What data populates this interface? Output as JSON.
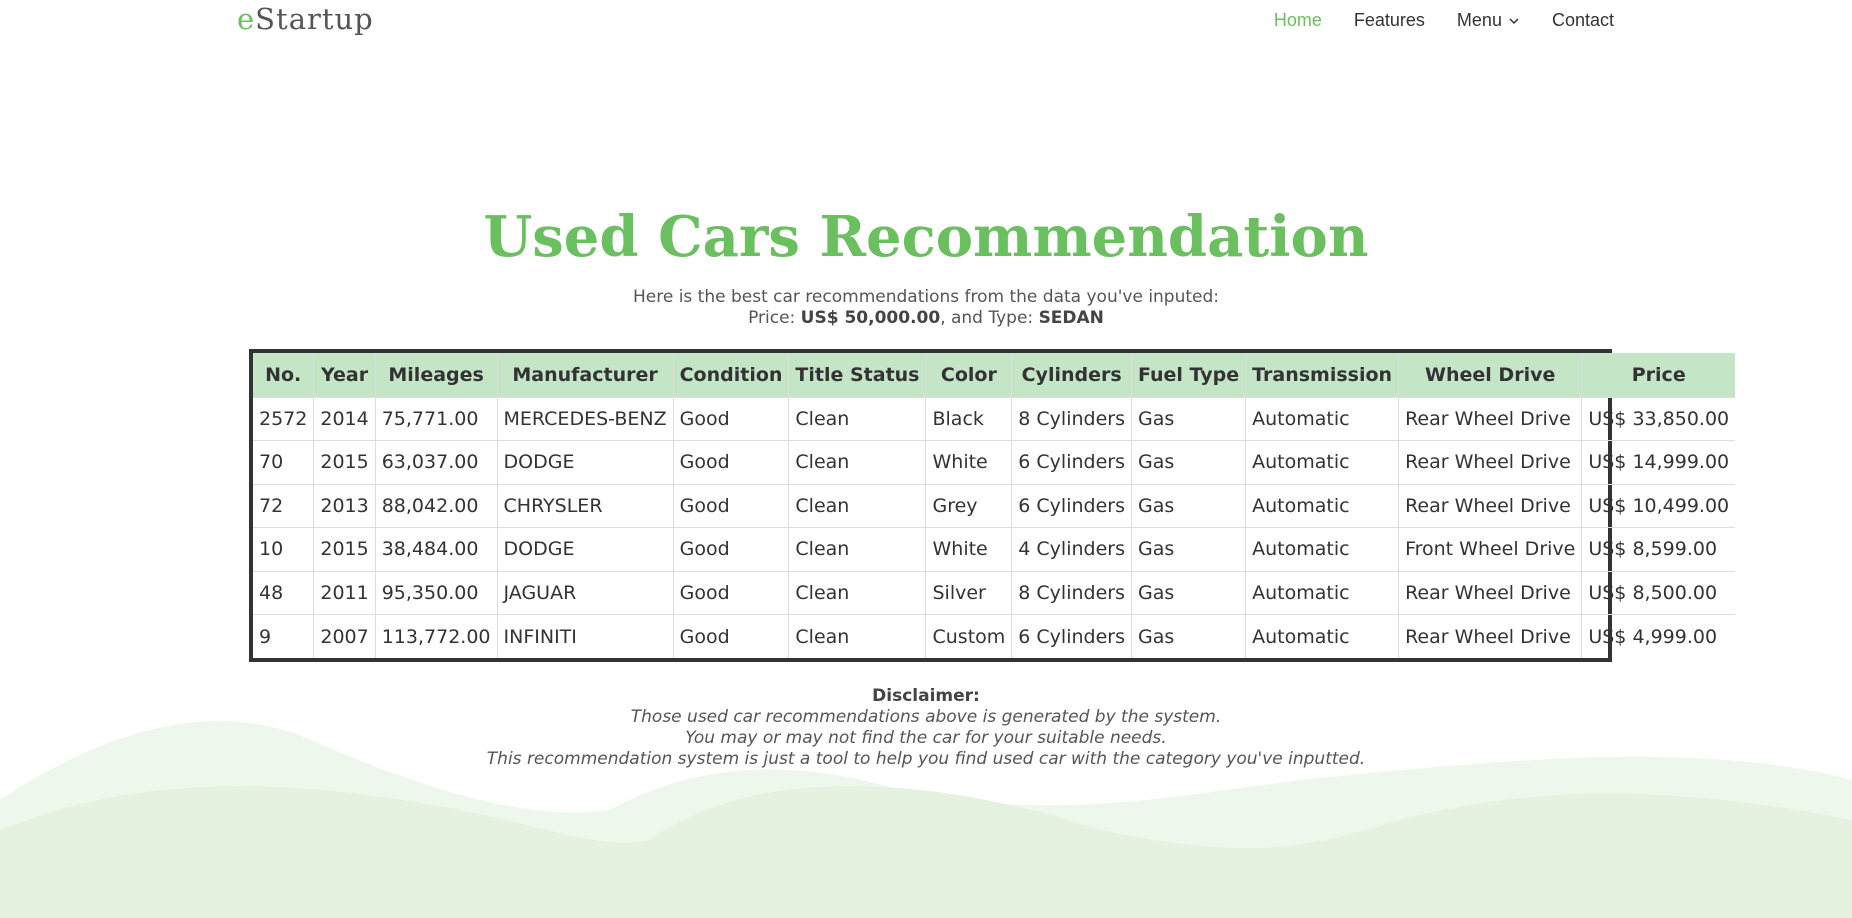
{
  "brand": {
    "prefix": "e",
    "name": "Startup"
  },
  "nav": {
    "home": "Home",
    "features": "Features",
    "menu": "Menu",
    "contact": "Contact"
  },
  "colors": {
    "accent": "#6abf5e",
    "header_bg": "#c4e6c6",
    "wave": "#e6f3e2"
  },
  "page_title": "Used Cars Recommendation",
  "intro": {
    "line1": "Here is the best car recommendations from the data you've inputed:",
    "price_label": "Price:",
    "price_value": "US$ 50,000.00",
    "type_label": ", and Type:",
    "type_value": "SEDAN"
  },
  "table": {
    "headers": [
      "No.",
      "Year",
      "Mileages",
      "Manufacturer",
      "Condition",
      "Title Status",
      "Color",
      "Cylinders",
      "Fuel Type",
      "Transmission",
      "Wheel Drive",
      "Price"
    ],
    "rows": [
      [
        "2572",
        "2014",
        "75,771.00",
        "MERCEDES-BENZ",
        "Good",
        "Clean",
        "Black",
        "8 Cylinders",
        "Gas",
        "Automatic",
        "Rear Wheel Drive",
        "US$ 33,850.00"
      ],
      [
        "70",
        "2015",
        "63,037.00",
        "DODGE",
        "Good",
        "Clean",
        "White",
        "6 Cylinders",
        "Gas",
        "Automatic",
        "Rear Wheel Drive",
        "US$ 14,999.00"
      ],
      [
        "72",
        "2013",
        "88,042.00",
        "CHRYSLER",
        "Good",
        "Clean",
        "Grey",
        "6 Cylinders",
        "Gas",
        "Automatic",
        "Rear Wheel Drive",
        "US$ 10,499.00"
      ],
      [
        "10",
        "2015",
        "38,484.00",
        "DODGE",
        "Good",
        "Clean",
        "White",
        "4 Cylinders",
        "Gas",
        "Automatic",
        "Front Wheel Drive",
        "US$ 8,599.00"
      ],
      [
        "48",
        "2011",
        "95,350.00",
        "JAGUAR",
        "Good",
        "Clean",
        "Silver",
        "8 Cylinders",
        "Gas",
        "Automatic",
        "Rear Wheel Drive",
        "US$ 8,500.00"
      ],
      [
        "9",
        "2007",
        "113,772.00",
        "INFINITI",
        "Good",
        "Clean",
        "Custom",
        "6 Cylinders",
        "Gas",
        "Automatic",
        "Rear Wheel Drive",
        "US$ 4,999.00"
      ]
    ]
  },
  "disclaimer": {
    "heading": "Disclaimer:",
    "line1": "Those used car recommendations above is generated by the system.",
    "line2": "You may or may not find the car for your suitable needs.",
    "line3": "This recommendation system is just a tool to help you find used car with the category you've inputted."
  }
}
